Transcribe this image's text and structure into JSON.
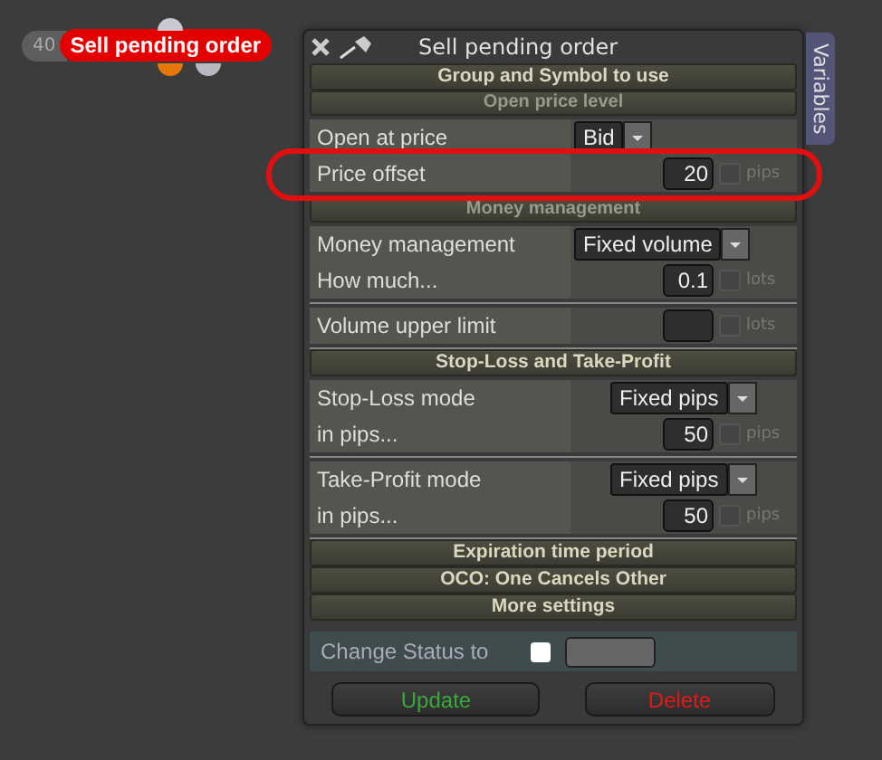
{
  "node": {
    "count": "40",
    "label": "Sell pending order"
  },
  "dialog": {
    "title": "Sell pending order",
    "side_tab": "Variables",
    "sections": [
      {
        "kind": "header",
        "text": "Group and Symbol to use"
      },
      {
        "kind": "subheader",
        "text": "Open price level"
      },
      {
        "kind": "group",
        "rows": [
          {
            "label": "Open at price",
            "control": {
              "kind": "dropdown",
              "value": "Bid"
            },
            "highlighted": false
          },
          {
            "label": "Price offset",
            "control": {
              "kind": "number",
              "value": "20",
              "unit": "pips",
              "checked": false
            },
            "highlighted": true
          }
        ]
      },
      {
        "kind": "subheader",
        "text": "Money management"
      },
      {
        "kind": "group",
        "rows": [
          {
            "label": "Money management",
            "control": {
              "kind": "dropdown",
              "value": "Fixed volume"
            },
            "highlighted": false
          },
          {
            "label": "How much...",
            "control": {
              "kind": "number",
              "value": "0.1",
              "unit": "lots",
              "checked": false
            },
            "highlighted": false
          }
        ]
      },
      {
        "kind": "group",
        "rows": [
          {
            "label": "Volume upper limit",
            "control": {
              "kind": "number",
              "unit": "lots",
              "checked": false
            },
            "highlighted": false
          }
        ]
      },
      {
        "kind": "header",
        "text": "Stop-Loss and Take-Profit"
      },
      {
        "kind": "group",
        "rows": [
          {
            "label": "Stop-Loss mode",
            "control": {
              "kind": "dropdown",
              "value": "Fixed pips"
            },
            "highlighted": false
          },
          {
            "label": "in pips...",
            "control": {
              "kind": "number",
              "value": "50",
              "unit": "pips",
              "checked": false
            },
            "highlighted": false
          }
        ]
      },
      {
        "kind": "group",
        "rows": [
          {
            "label": "Take-Profit mode",
            "control": {
              "kind": "dropdown",
              "value": "Fixed pips"
            },
            "highlighted": false
          },
          {
            "label": "in pips...",
            "control": {
              "kind": "number",
              "value": "50",
              "unit": "pips",
              "checked": false
            },
            "highlighted": false
          }
        ]
      },
      {
        "kind": "header",
        "text": "Expiration time period"
      },
      {
        "kind": "header",
        "text": "OCO: One Cancels Other"
      },
      {
        "kind": "header",
        "text": "More settings"
      }
    ],
    "status": {
      "label": "Change Status to",
      "checked": false
    },
    "buttons": [
      {
        "label": "Update",
        "kind": "update"
      },
      {
        "label": "Delete",
        "kind": "delete"
      }
    ]
  }
}
